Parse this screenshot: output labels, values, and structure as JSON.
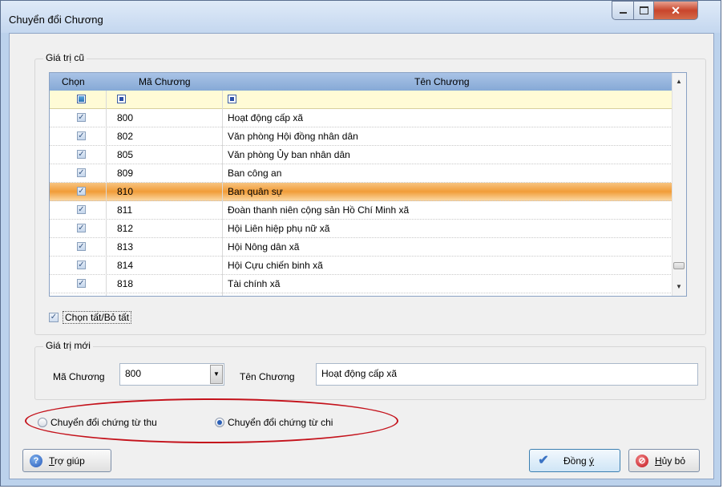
{
  "window": {
    "title": "Chuyển đổi Chương"
  },
  "old_group": {
    "label": "Giá trị cũ",
    "columns": [
      "Chọn",
      "Mã Chương",
      "Tên Chương"
    ],
    "rows": [
      {
        "code": "800",
        "name": "Hoạt động cấp xã",
        "checked": true
      },
      {
        "code": "802",
        "name": "Văn phòng Hội đồng nhân dân",
        "checked": true
      },
      {
        "code": "805",
        "name": "Văn phòng Ủy ban nhân dân",
        "checked": true
      },
      {
        "code": "809",
        "name": "Ban công an",
        "checked": true
      },
      {
        "code": "810",
        "name": "Ban quân sự",
        "checked": true,
        "selected": true
      },
      {
        "code": "811",
        "name": "Đoàn thanh niên cộng sản Hồ Chí Minh xã",
        "checked": true
      },
      {
        "code": "812",
        "name": "Hội Liên hiệp phụ nữ xã",
        "checked": true
      },
      {
        "code": "813",
        "name": "Hội Nông dân xã",
        "checked": true
      },
      {
        "code": "814",
        "name": "Hội Cựu chiến binh xã",
        "checked": true
      },
      {
        "code": "818",
        "name": "Tài chính xã",
        "checked": true
      }
    ],
    "select_all_label": "Chọn tất/Bỏ tất",
    "select_all_checked": true
  },
  "new_group": {
    "label": "Giá trị mới",
    "code_label": "Mã Chương",
    "code_value": "800",
    "name_label": "Tên Chương",
    "name_value": "Hoạt động cấp xã"
  },
  "options": {
    "receipt_label": "Chuyển đổi chứng từ thu",
    "expense_label": "Chuyển đổi chứng từ chi",
    "selected": "expense"
  },
  "buttons": {
    "help": {
      "mnemonic": "T",
      "rest": "rợ giúp"
    },
    "ok": {
      "prefix": "Đồng ",
      "mnemonic": "ý"
    },
    "cancel": {
      "mnemonic": "H",
      "rest": "ủy bỏ"
    }
  },
  "colors": {
    "selected_row": "#f19c38",
    "filter_row": "#fffbd6",
    "header": "#86a9d6",
    "highlight_ellipse": "#c4121b"
  }
}
